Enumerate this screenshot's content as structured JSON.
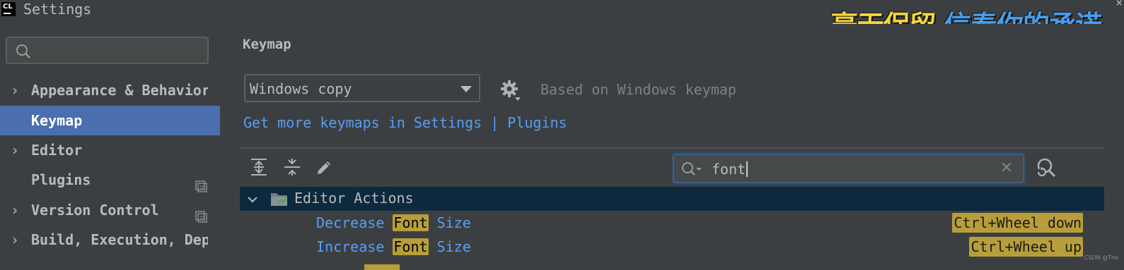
{
  "window": {
    "title": "Settings",
    "app_icon_text": "CL",
    "watermark_part1": "毫无保留",
    "watermark_part2": "信奉你的承诺",
    "close_glyph": "×"
  },
  "sidebar": {
    "search_placeholder": "",
    "items": [
      {
        "label": "Appearance & Behavior",
        "chevron": "›",
        "selected": false,
        "has_config_icon": false
      },
      {
        "label": "Keymap",
        "chevron": "",
        "selected": true,
        "has_config_icon": false
      },
      {
        "label": "Editor",
        "chevron": "›",
        "selected": false,
        "has_config_icon": false
      },
      {
        "label": "Plugins",
        "chevron": "",
        "selected": false,
        "has_config_icon": true
      },
      {
        "label": "Version Control",
        "chevron": "›",
        "selected": false,
        "has_config_icon": true
      },
      {
        "label": "Build, Execution, Deployment",
        "chevron": "›",
        "selected": false,
        "has_config_icon": false
      }
    ]
  },
  "main": {
    "title": "Keymap",
    "keymap_select_value": "Windows copy",
    "based_on": "Based on Windows keymap",
    "link_text": "Get more keymaps in Settings",
    "link_separator": "|",
    "link_plugins": "Plugins",
    "toolbar_icons": [
      "expand-all-icon",
      "collapse-all-icon",
      "edit-icon"
    ],
    "filter_value": "font",
    "filter_clear": "✕"
  },
  "tree": {
    "group_label": "Editor Actions",
    "rows": [
      {
        "pre": "Decrease ",
        "match": "Font",
        "post": " Size",
        "shortcut": "Ctrl+Wheel down"
      },
      {
        "pre": "Increase ",
        "match": "Font",
        "post": " Size",
        "shortcut": "Ctrl+Wheel up"
      }
    ]
  },
  "footer": {
    "tiny_credit": "CSDN @The"
  },
  "colors": {
    "background": "#3c3f41",
    "selection": "#4b6eaf",
    "link": "#589df6",
    "highlight": "#b89e3a",
    "group_row": "#0d293e"
  }
}
